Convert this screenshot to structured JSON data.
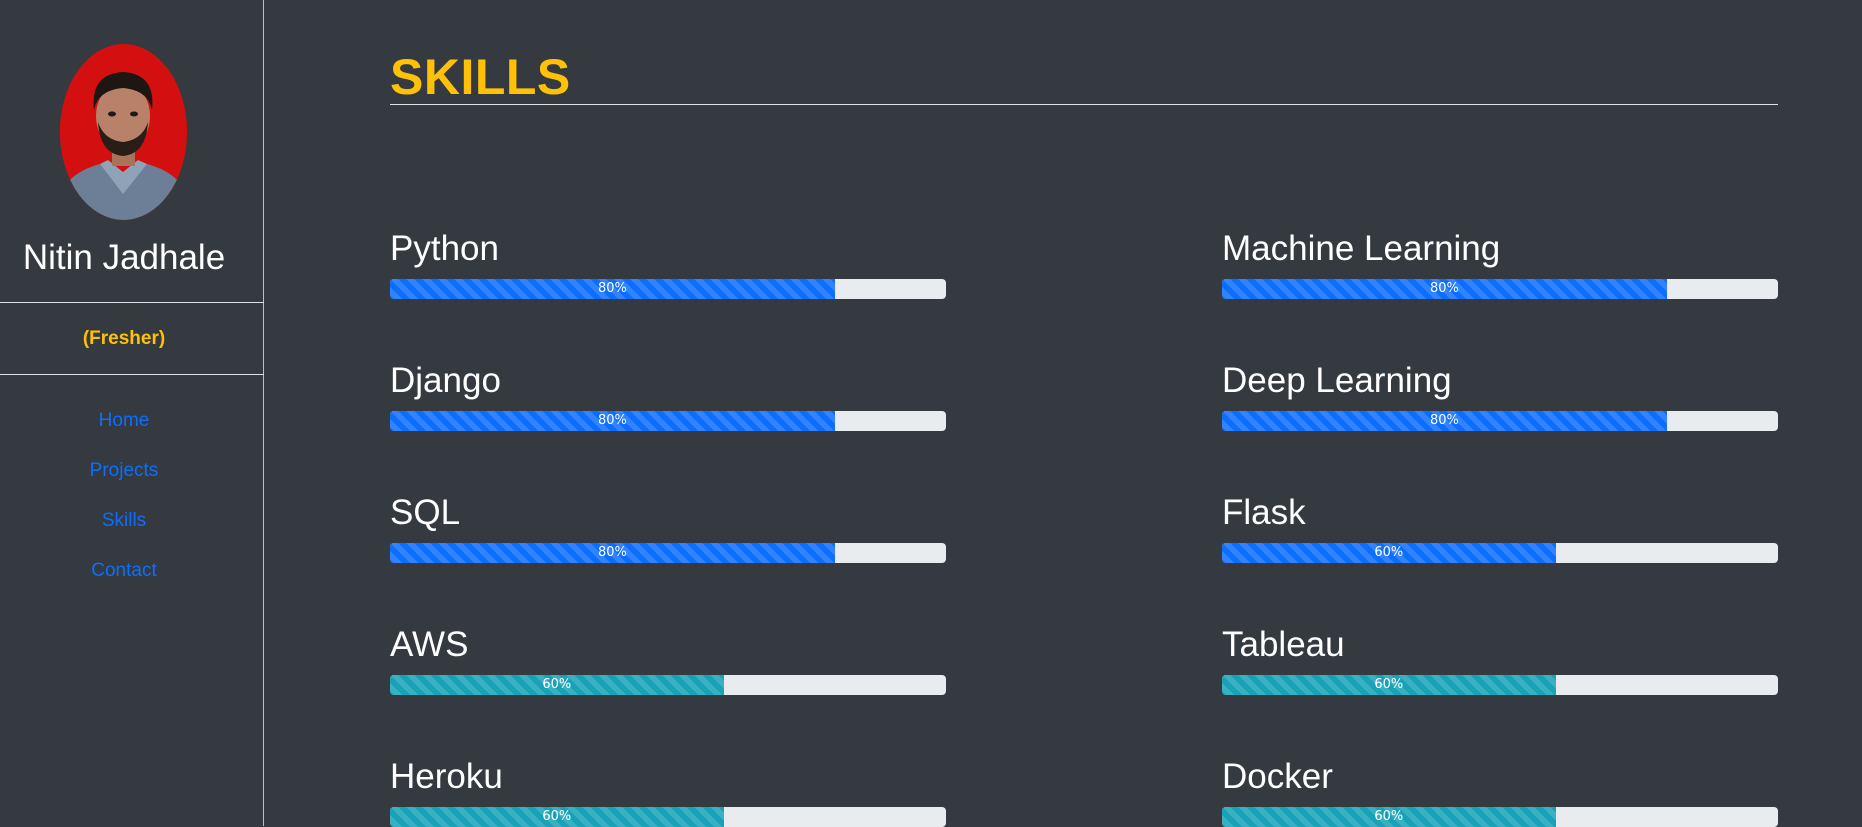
{
  "sidebar": {
    "name": "Nitin Jadhale",
    "status": "(Fresher)",
    "nav": [
      "Home",
      "Projects",
      "Skills",
      "Contact"
    ],
    "avatar_bg": "#d40f0f"
  },
  "main": {
    "title": "SKILLS"
  },
  "colors": {
    "accent": "#ffc107",
    "link": "#0d6efd",
    "bar_primary": "#0d6efd",
    "bar_info": "#17a2b8",
    "bar_track": "#e9ecef",
    "background": "#343a40"
  },
  "skills": [
    {
      "name": "Python",
      "level": 80,
      "label": "80%",
      "variant": "primary"
    },
    {
      "name": "Machine Learning",
      "level": 80,
      "label": "80%",
      "variant": "primary"
    },
    {
      "name": "Django",
      "level": 80,
      "label": "80%",
      "variant": "primary"
    },
    {
      "name": "Deep Learning",
      "level": 80,
      "label": "80%",
      "variant": "primary"
    },
    {
      "name": "SQL",
      "level": 80,
      "label": "80%",
      "variant": "primary"
    },
    {
      "name": "Flask",
      "level": 60,
      "label": "60%",
      "variant": "primary"
    },
    {
      "name": "AWS",
      "level": 60,
      "label": "60%",
      "variant": "info"
    },
    {
      "name": "Tableau",
      "level": 60,
      "label": "60%",
      "variant": "info"
    },
    {
      "name": "Heroku",
      "level": 60,
      "label": "60%",
      "variant": "info"
    },
    {
      "name": "Docker",
      "level": 60,
      "label": "60%",
      "variant": "info"
    }
  ]
}
